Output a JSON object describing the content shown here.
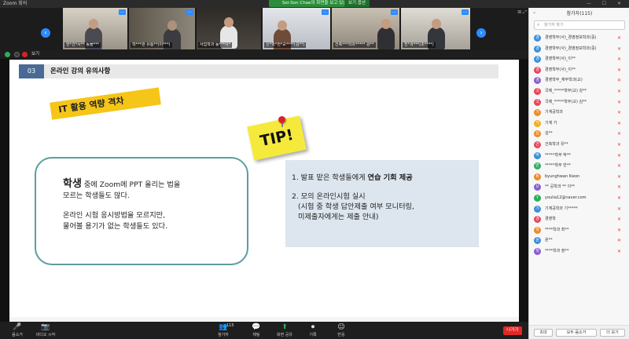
{
  "window": {
    "title": "Zoom 회의",
    "controls": "— ☐ ✕"
  },
  "share_banner": {
    "text": "Sei-Son Chae의 화면을 보고 있습니다.",
    "options_label": "보기 옵션"
  },
  "strip": {
    "prev_label": "‹",
    "next_label": "›",
    "tools": "⊞ ⤢",
    "tiles": [
      {
        "name": "한*건*사** 동물***"
      },
      {
        "name": "학***관 유통**(이***)"
      },
      {
        "name": "사업학과 동***이*"
      },
      {
        "name": "신*학*전*교****(김**)"
      },
      {
        "name": "건축***학과***** 강**"
      },
      {
        "name": "전*과***(조****)"
      }
    ]
  },
  "share_header": {
    "label": "보기"
  },
  "slide": {
    "section_number": "03",
    "section_title": "온라인 강의 유의사항",
    "banner": "IT 활용 역량 격차",
    "tip": "TIP!",
    "bubble": {
      "p1_big": "학생",
      "p1_rest": " 중에 Zoom에 PPT 올리는 법을",
      "p1_line2": "모르는 학생들도 많다.",
      "p2_line1": "온라인 시험 응시방법을 모르지만,",
      "p2_line2": "물어볼 용기가 없는 학생들도 있다."
    },
    "tips": {
      "item1_pre": "1. 발표  맡은 학생들에게 ",
      "item1_bold": "연습 기회 제공",
      "item2": "2.  모의 온라인시험 실시",
      "item2_sub1": "(시험 중 학생 답안제출 여부 모니터링,",
      "item2_sub2": "미제출자에게는 제출 안내)"
    }
  },
  "toolbar": {
    "items": [
      {
        "label": "음소거",
        "glyph": "🎤"
      },
      {
        "label": "비디오 시작",
        "glyph": "📷"
      },
      {
        "label": "참가자",
        "glyph": "👥",
        "count": "115"
      },
      {
        "label": "채팅",
        "glyph": "💬"
      },
      {
        "label": "화면 공유",
        "glyph": "⬆"
      },
      {
        "label": "기록",
        "glyph": "⏺"
      },
      {
        "label": "반응",
        "glyph": "☺"
      }
    ],
    "end_label": "나가기"
  },
  "panel": {
    "title": "참가자(115)",
    "search_placeholder": "참가자 찾기",
    "participants": [
      {
        "name": "경영학부(사)_경영정보학과(중)",
        "initial": "경",
        "color": "#3a8fd8"
      },
      {
        "name": "경영학부(사)_경영정보학과(중)",
        "initial": "경",
        "color": "#3a8fd8"
      },
      {
        "name": "경영학부(사)_이**",
        "initial": "경",
        "color": "#3a8fd8"
      },
      {
        "name": "경영학부(사)_이**",
        "initial": "경",
        "color": "#e8465b"
      },
      {
        "name": "경영학부_재무학과(교)",
        "initial": "경",
        "color": "#8a5cd6"
      },
      {
        "name": "국제_*****학부(교) 강**",
        "initial": "국",
        "color": "#e8465b"
      },
      {
        "name": "국제_*****학부(교) 김**",
        "initial": "국",
        "color": "#e8465b"
      },
      {
        "name": "기계공학과",
        "initial": "기",
        "color": "#f08a24"
      },
      {
        "name": "기계 가",
        "initial": "기",
        "color": "#f0b020"
      },
      {
        "name": "김**",
        "initial": "김",
        "color": "#f08a24"
      },
      {
        "name": "건축학과 유**",
        "initial": "건",
        "color": "#e8465b"
      },
      {
        "name": "*****학부 박**",
        "initial": "박",
        "color": "#3a8fd8"
      },
      {
        "name": "*****학부 반**",
        "initial": "반",
        "color": "#2dae5a"
      },
      {
        "name": "byunghwan Kwon",
        "initial": "B",
        "color": "#f08a24"
      },
      {
        "name": "** 공학과 ** 이**",
        "initial": "U",
        "color": "#8a5cd6"
      },
      {
        "name": "youlia12@naver.com",
        "initial": "Y",
        "color": "#2dae5a"
      },
      {
        "name": "기계공학과 기*****",
        "initial": "기",
        "color": "#3a8fd8"
      },
      {
        "name": "경영학",
        "initial": "경",
        "color": "#e8465b"
      },
      {
        "name": "****학과 최**",
        "initial": "학",
        "color": "#f08a24"
      },
      {
        "name": "윤**",
        "initial": "윤",
        "color": "#3a8fd8"
      },
      {
        "name": "****학과 정**",
        "initial": "학",
        "color": "#8a5cd6"
      }
    ],
    "footer": {
      "invite": "초대",
      "mute_all": "모두 음소거",
      "more": "더 보기"
    }
  },
  "colors": {
    "accent": "#2d8cff",
    "section_blue": "#4a6a96",
    "banner_yellow": "#f5c518",
    "bubble_border": "#5b9ea0",
    "end_red": "#e02828"
  }
}
